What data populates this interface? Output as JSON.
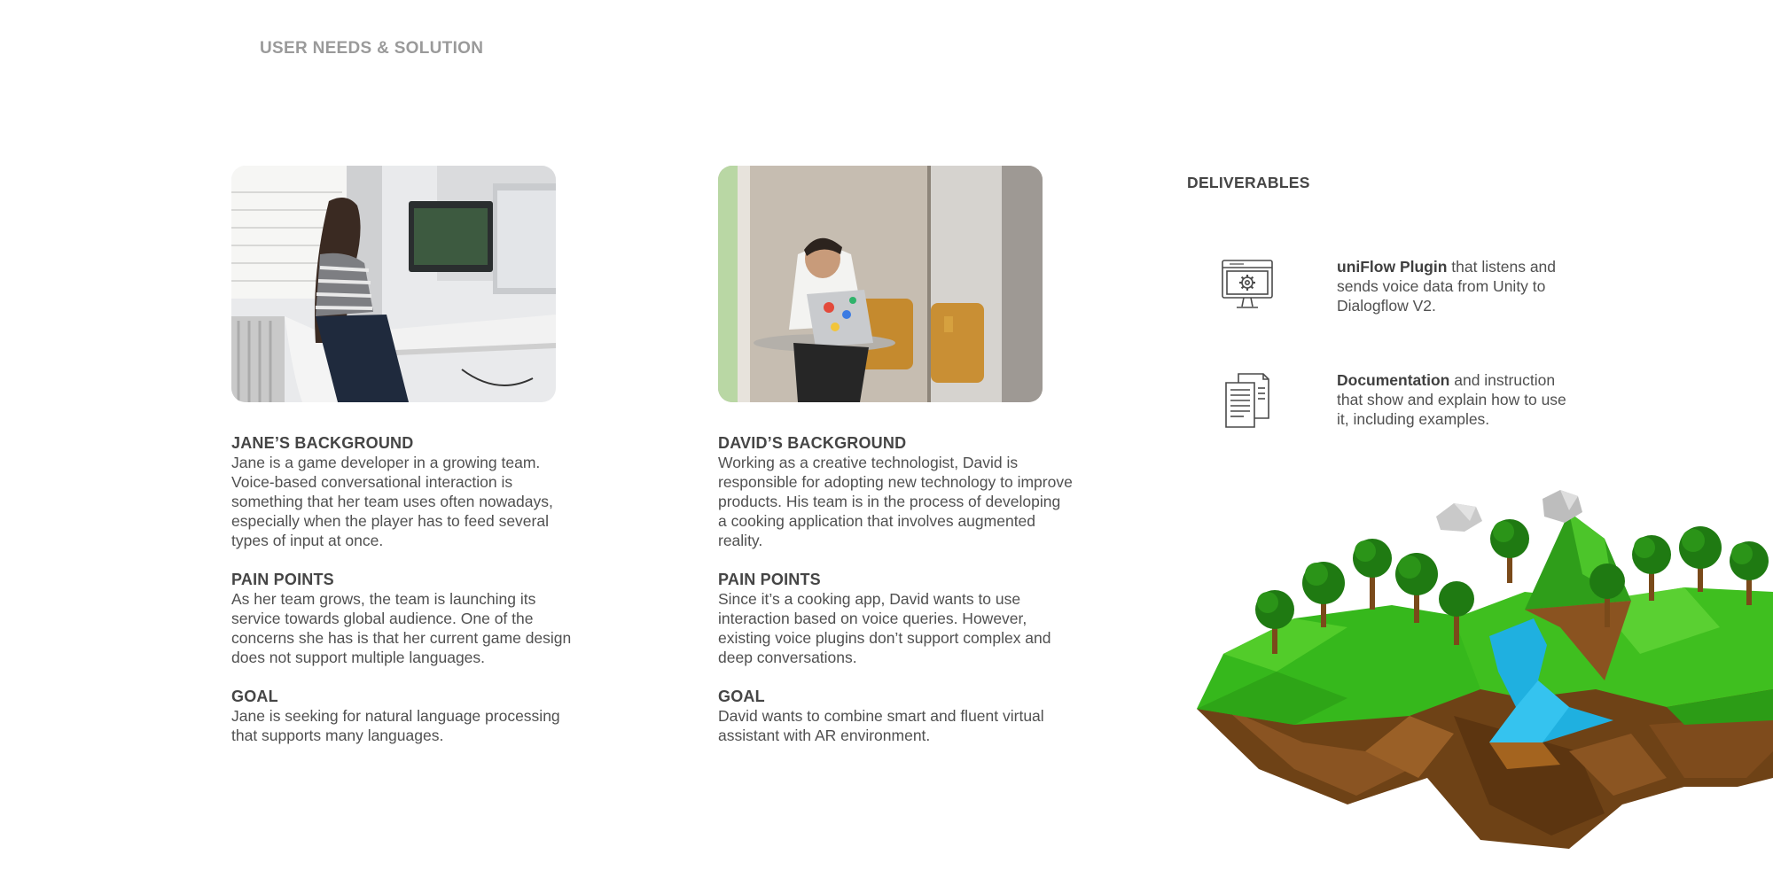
{
  "page_title": "USER NEEDS & SOLUTION",
  "personas": [
    {
      "background_heading": "JANE’S BACKGROUND",
      "background_text": "Jane is a game developer in a growing team. Voice-based conversational interaction is something that her team uses often nowadays, especially when the player has to feed several types of input at once.",
      "pain_heading": "PAIN POINTS",
      "pain_text": "As her team grows, the team is launching its service towards global audience. One of the concerns she has is that her current game design does not support multiple languages.",
      "goal_heading": "GOAL",
      "goal_text": "Jane is seeking for natural language processing that supports many languages."
    },
    {
      "background_heading": "DAVID’S BACKGROUND",
      "background_text": "Working as a creative technologist, David is responsible for adopting new technology to improve products. His team is in the process of developing a cooking application that involves augmented reality.",
      "pain_heading": "PAIN POINTS",
      "pain_text": "Since it’s a cooking app, David wants to use interaction based on voice queries. However, existing voice plugins don’t support complex and deep conversations.",
      "goal_heading": "GOAL",
      "goal_text": "David wants to combine smart and fluent virtual assistant with AR environment."
    }
  ],
  "deliverables": {
    "title": "DELIVERABLES",
    "items": [
      {
        "icon": "monitor-gear-icon",
        "bold": "uniFlow Plugin",
        "text": " that listens and sends voice data from Unity to Dialogflow V2."
      },
      {
        "icon": "documents-icon",
        "bold": "Documentation",
        "text": " and instruction that show and explain how to use it, including examples."
      }
    ]
  },
  "colors": {
    "title_gray": "#9a9a9a",
    "text": "#505050",
    "heading": "#454545",
    "grass": "#3fbf1f",
    "water": "#1fb0e0",
    "earth": "#7a4a1a"
  }
}
